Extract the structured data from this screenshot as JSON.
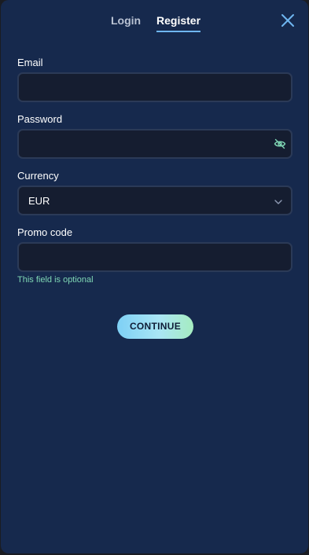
{
  "tabs": {
    "login": "Login",
    "register": "Register"
  },
  "form": {
    "email_label": "Email",
    "email_value": "",
    "password_label": "Password",
    "password_value": "",
    "currency_label": "Currency",
    "currency_value": "EUR",
    "promo_label": "Promo code",
    "promo_value": "",
    "promo_hint": "This field is optional"
  },
  "actions": {
    "continue_label": "CONTINUE"
  },
  "icons": {
    "close": "close-icon",
    "password_visibility": "eye-off-icon",
    "dropdown": "chevron-down-icon"
  },
  "colors": {
    "background": "#16294d",
    "accent": "#6fb6f0",
    "hint": "#7fd6b4"
  }
}
